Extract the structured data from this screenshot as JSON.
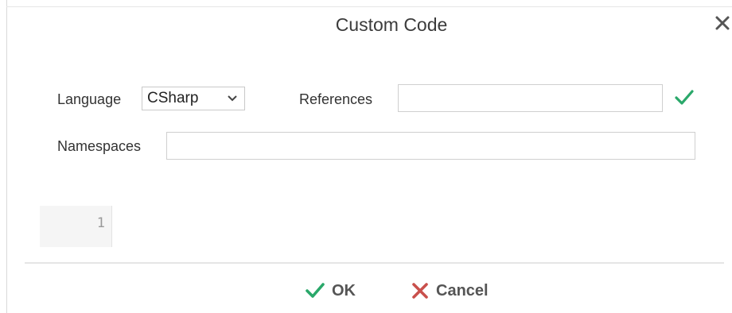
{
  "dialog": {
    "title": "Custom Code",
    "close_icon": "close-icon"
  },
  "form": {
    "language_label": "Language",
    "language_value": "CSharp",
    "references_label": "References",
    "references_value": "",
    "namespaces_label": "Namespaces",
    "namespaces_value": ""
  },
  "editor": {
    "line_numbers": [
      "1"
    ],
    "code": ""
  },
  "footer": {
    "ok_label": "OK",
    "cancel_label": "Cancel"
  },
  "colors": {
    "check_green": "#2aa86a",
    "cancel_red": "#c9504c"
  }
}
